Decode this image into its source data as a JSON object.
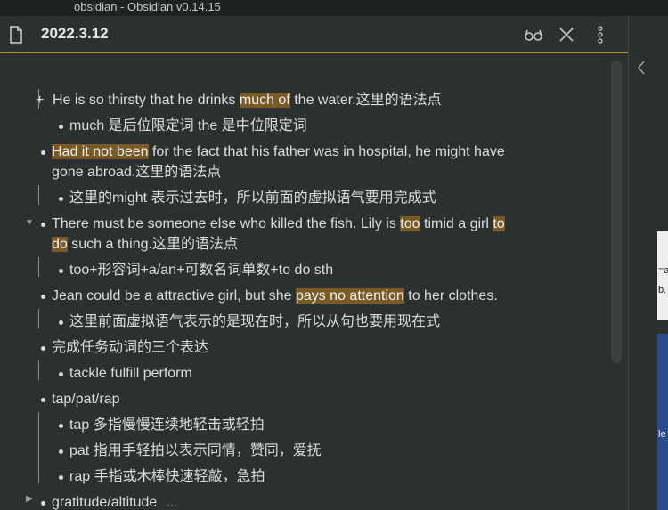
{
  "window": {
    "title": "obsidian - Obsidian v0.14.15"
  },
  "header": {
    "title": "2022.3.12"
  },
  "icons": {
    "file": "file-icon",
    "reading_mode": "glasses-icon",
    "close": "close-icon",
    "more": "more-vertical-icon",
    "collapse_sidebar": "chevron-left-icon"
  },
  "colors": {
    "accent": "#c48a2e",
    "highlight": "#7a5a25",
    "background": "#2b3131"
  },
  "outline": {
    "l1": {
      "pre": "He is so thirsty that he drinks ",
      "hl": "much of",
      "post": " the water.这里的语法点"
    },
    "l2": "much 是后位限定词 the 是中位限定词",
    "l3a": {
      "hl": "Had it not been",
      "post": " for the fact that his father was in hospital, he might have"
    },
    "l3b": "gone abroad.这里的语法点",
    "l4": "这里的might 表示过去时，所以前面的虚拟语气要用完成式",
    "l5a": {
      "pre": "There must be someone else who killed the fish. Lily is ",
      "hl1": "too",
      "mid": " timid a girl ",
      "hl2": "to"
    },
    "l5b": {
      "hl": "do",
      "post": " such a thing.这里的语法点"
    },
    "l6": "too+形容词+a/an+可数名词单数+to do sth",
    "l7": {
      "pre": "Jean could be a attractive girl, but she ",
      "hl": "pays no attention",
      "post": " to her clothes."
    },
    "l8": "这里前面虚拟语气表示的是现在时，所以从句也要用现在式",
    "l9": "完成任务动词的三个表达",
    "l10": "tackle fulfill perform",
    "l11": "tap/pat/rap",
    "l12": "tap 多指慢慢连续地轻击或轻拍",
    "l13": "pat 指用手轻拍以表示同情，赞同，爱抚",
    "l14": "rap 手指或木棒快速轻敲，急拍",
    "l15": "gratitude/altitude",
    "l15_ellipsis": "..."
  },
  "side_peek": {
    "t1": "=a",
    "t2": "b.",
    "t3": "le"
  }
}
